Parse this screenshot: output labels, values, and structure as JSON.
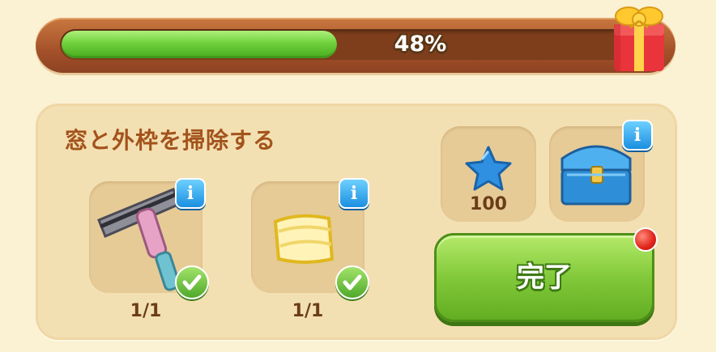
{
  "progress": {
    "percent": 48,
    "label": "48%",
    "reward_icon": "gift-box-icon"
  },
  "task": {
    "title": "窓と外枠を掃除する",
    "items": [
      {
        "icon": "squeegee-icon",
        "count": "1/1",
        "completed": true
      },
      {
        "icon": "cleaning-cloth-icon",
        "count": "1/1",
        "completed": true
      }
    ],
    "rewards": [
      {
        "icon": "blue-star-icon",
        "amount": "100"
      },
      {
        "icon": "blue-treasure-chest-icon"
      }
    ],
    "complete_label": "完了"
  },
  "colors": {
    "accent_green": "#82c93a",
    "title_brown": "#a3531c",
    "info_blue": "#1b8fe0"
  }
}
